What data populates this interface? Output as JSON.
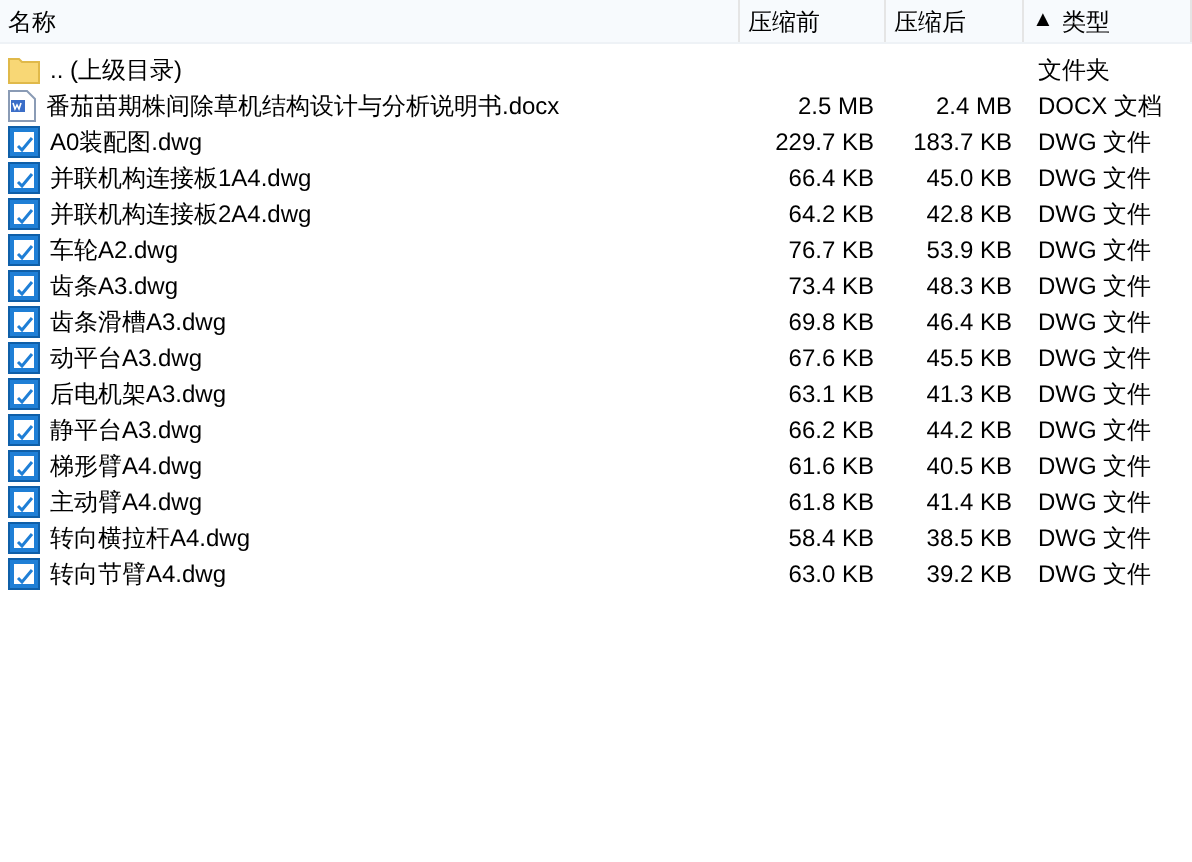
{
  "columns": [
    {
      "label": "名称"
    },
    {
      "label": "压缩前"
    },
    {
      "label": "压缩后"
    },
    {
      "label": "类型",
      "sort_indicator": "▲"
    }
  ],
  "rows": [
    {
      "kind": "folder",
      "name": ".. (上级目录)",
      "type": "文件夹"
    },
    {
      "kind": "docx",
      "name": "番茄苗期株间除草机结构设计与分析说明书.docx",
      "size": "2.5 MB",
      "packed": "2.4 MB",
      "type": "DOCX 文档"
    },
    {
      "kind": "dwg",
      "name": "A0装配图.dwg",
      "size": "229.7 KB",
      "packed": "183.7 KB",
      "type": "DWG 文件"
    },
    {
      "kind": "dwg",
      "name": "并联机构连接板1A4.dwg",
      "size": "66.4 KB",
      "packed": "45.0 KB",
      "type": "DWG 文件"
    },
    {
      "kind": "dwg",
      "name": "并联机构连接板2A4.dwg",
      "size": "64.2 KB",
      "packed": "42.8 KB",
      "type": "DWG 文件"
    },
    {
      "kind": "dwg",
      "name": "车轮A2.dwg",
      "size": "76.7 KB",
      "packed": "53.9 KB",
      "type": "DWG 文件"
    },
    {
      "kind": "dwg",
      "name": "齿条A3.dwg",
      "size": "73.4 KB",
      "packed": "48.3 KB",
      "type": "DWG 文件"
    },
    {
      "kind": "dwg",
      "name": "齿条滑槽A3.dwg",
      "size": "69.8 KB",
      "packed": "46.4 KB",
      "type": "DWG 文件"
    },
    {
      "kind": "dwg",
      "name": "动平台A3.dwg",
      "size": "67.6 KB",
      "packed": "45.5 KB",
      "type": "DWG 文件"
    },
    {
      "kind": "dwg",
      "name": "后电机架A3.dwg",
      "size": "63.1 KB",
      "packed": "41.3 KB",
      "type": "DWG 文件"
    },
    {
      "kind": "dwg",
      "name": "静平台A3.dwg",
      "size": "66.2 KB",
      "packed": "44.2 KB",
      "type": "DWG 文件"
    },
    {
      "kind": "dwg",
      "name": "梯形臂A4.dwg",
      "size": "61.6 KB",
      "packed": "40.5 KB",
      "type": "DWG 文件"
    },
    {
      "kind": "dwg",
      "name": "主动臂A4.dwg",
      "size": "61.8 KB",
      "packed": "41.4 KB",
      "type": "DWG 文件"
    },
    {
      "kind": "dwg",
      "name": "转向横拉杆A4.dwg",
      "size": "58.4 KB",
      "packed": "38.5 KB",
      "type": "DWG 文件"
    },
    {
      "kind": "dwg",
      "name": "转向节臂A4.dwg",
      "size": "63.0 KB",
      "packed": "39.2 KB",
      "type": "DWG 文件"
    }
  ]
}
